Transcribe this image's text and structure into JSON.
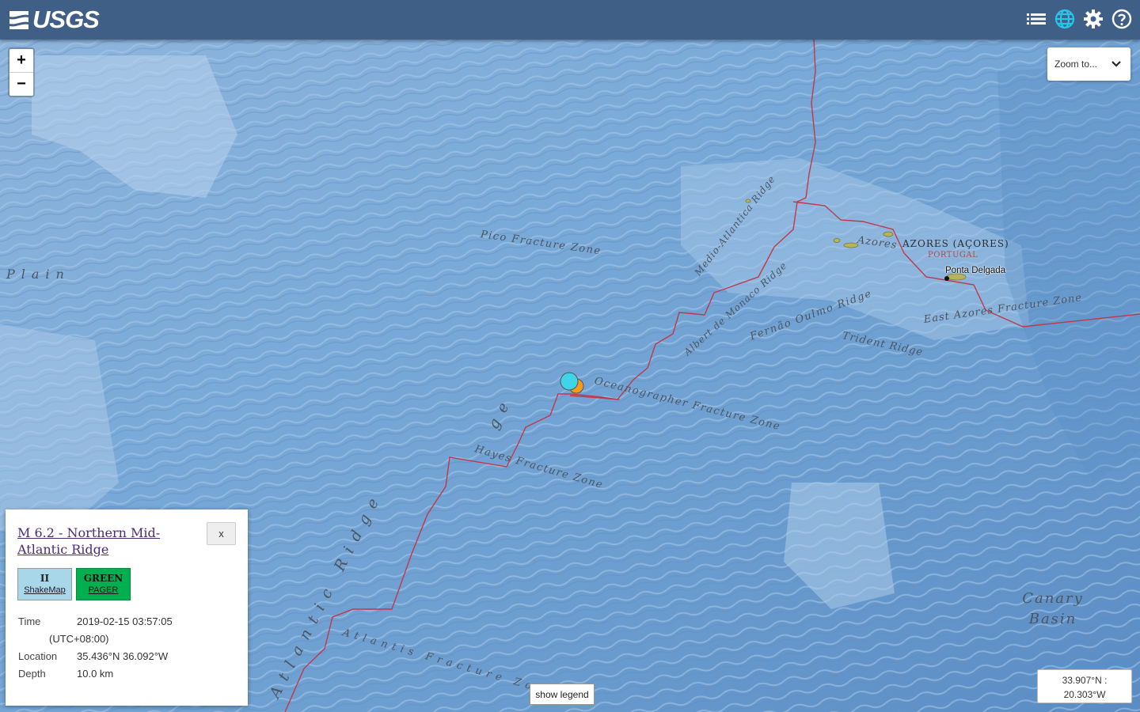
{
  "header": {
    "logo_text": "USGS",
    "icons": [
      "list-icon",
      "globe-icon",
      "gear-icon",
      "help-icon"
    ],
    "bg_color": "#3f5f86",
    "globe_color": "#29c4e8"
  },
  "map": {
    "zoom_in": "+",
    "zoom_out": "−",
    "zoom_to_label": "Zoom to...",
    "labels": {
      "pico": "Pico Fracture Zone",
      "plain": "Plain",
      "medio": "Medio-Atlantica Ridge",
      "azores": "Azores",
      "albert": "Albert de Monaco Ridge",
      "fernao": "Fernão Oulmo Ridge",
      "trident": "Trident Ridge",
      "east_azores": "East Azores Fracture Zone",
      "oceanographer": "Oceanographer Fracture Zone",
      "hayes": "Hayes Fracture Zone",
      "mid_atlantic_ridge": "Atlantic Ridge",
      "ridge_upper": "ge",
      "atlantis": "Atlantis Fracture Zone",
      "canary_basin_line1": "Canary",
      "canary_basin_line2": "Basin",
      "country": "AZORES (AÇORES)",
      "country_sub": "PORTUGAL",
      "city": "Ponta Delgada"
    },
    "plate_boundary_color": "#c0394b",
    "markers": [
      {
        "name": "M 6.2 event",
        "color": "#3fd4e8"
      },
      {
        "name": "nearby event",
        "color": "#f29b1d"
      }
    ]
  },
  "event": {
    "title": "M 6.2 - Northern Mid-Atlantic Ridge",
    "close": "x",
    "shakemap_value": "II",
    "shakemap_label": "ShakeMap",
    "pager_value": "GREEN",
    "pager_label": "PAGER",
    "time_label": "Time",
    "time_value": "2019-02-15 03:57:05",
    "time_zone": "(UTC+08:00)",
    "location_label": "Location",
    "location_value": "35.436°N 36.092°W",
    "depth_label": "Depth",
    "depth_value": "10.0 km"
  },
  "legend_button": "show legend",
  "coordinates": {
    "line1": "33.907°N :",
    "line2": "20.303°W"
  }
}
